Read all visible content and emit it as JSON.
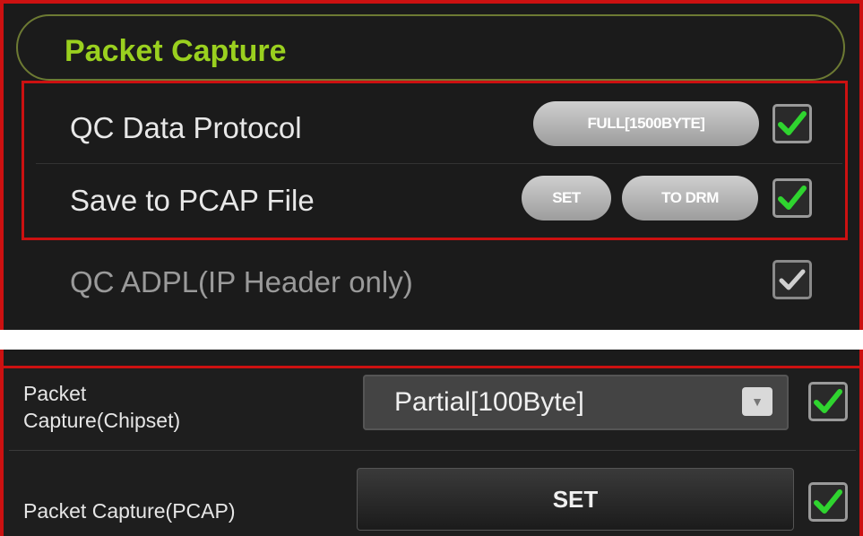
{
  "header": {
    "title": "Packet Capture"
  },
  "rows": [
    {
      "label": "QC Data Protocol",
      "button": "FULL[1500BYTE]",
      "checked": true,
      "check_color": "#2fd42f"
    },
    {
      "label": "Save to PCAP File",
      "buttons": [
        "SET",
        "TO DRM"
      ],
      "checked": true,
      "check_color": "#2fd42f"
    },
    {
      "label": "QC ADPL(IP Header only)",
      "checked": true,
      "check_color": "#cfcfcf",
      "disabled": true
    }
  ],
  "chipset": {
    "label_line1": "Packet",
    "label_line2": "Capture(Chipset)",
    "selected": "Partial[100Byte]",
    "checked": true
  },
  "pcap": {
    "label": "Packet Capture(PCAP)",
    "button": "SET",
    "checked": true
  },
  "colors": {
    "accent_title": "#9ad01f",
    "highlight_border": "#cc1111",
    "check_green": "#2fd42f"
  }
}
